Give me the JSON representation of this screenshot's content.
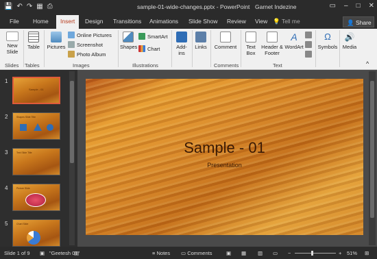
{
  "titlebar": {
    "doc_title": "sample-01-wide-changes.pptx - PowerPoint",
    "user": "Garnet Indezine",
    "qat": [
      "💾",
      "↶",
      "↷",
      "▦",
      "⎙"
    ]
  },
  "tabs": [
    "File",
    "Home",
    "Insert",
    "Design",
    "Transitions",
    "Animations",
    "Slide Show",
    "Review",
    "View"
  ],
  "tell_me": "Tell me",
  "share": "Share",
  "ribbon": {
    "slides": {
      "new_slide": "New Slide",
      "group": "Slides"
    },
    "tables": {
      "table": "Table",
      "group": "Tables"
    },
    "images": {
      "pictures": "Pictures",
      "online_pictures": "Online Pictures",
      "screenshot": "Screenshot",
      "photo_album": "Photo Album",
      "group": "Images"
    },
    "illustrations": {
      "shapes": "Shapes",
      "smartart": "SmartArt",
      "chart": "Chart",
      "group": "Illustrations"
    },
    "addins": "Add-ins",
    "links": "Links",
    "comments": {
      "comment": "Comment",
      "group": "Comments"
    },
    "text": {
      "text_box": "Text Box",
      "header_footer": "Header & Footer",
      "wordart": "WordArt",
      "group": "Text"
    },
    "symbols": "Symbols",
    "media": "Media"
  },
  "thumbs": [
    {
      "num": "1",
      "title": "Sample - 01"
    },
    {
      "num": "2",
      "title": "Shapes Slide Title"
    },
    {
      "num": "3",
      "title": "Text Slide Title"
    },
    {
      "num": "4",
      "title": "Picture Slide"
    },
    {
      "num": "5",
      "title": "Chart Slide"
    }
  ],
  "slide": {
    "title": "Sample - 01",
    "subtitle": "Presentation"
  },
  "status": {
    "slide_of": "Slide 1 of 9",
    "theme": "\"Geetesh 01\"",
    "notes": "Notes",
    "comments": "Comments",
    "zoom": "51%"
  },
  "colors": {
    "accent": "#b83c1d",
    "selection": "#e05a3a"
  }
}
